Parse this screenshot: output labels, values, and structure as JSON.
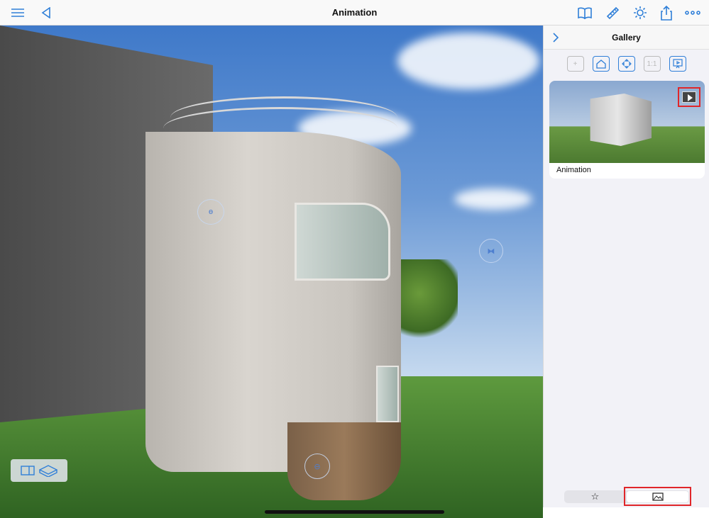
{
  "topbar": {
    "title": "Animation",
    "left_icons": [
      "menu-icon",
      "back-icon"
    ],
    "right_icons": [
      "book-icon",
      "ruler-icon",
      "sun-icon",
      "share-icon",
      "more-icon"
    ]
  },
  "gallery": {
    "title": "Gallery",
    "tools": [
      {
        "name": "add-icon",
        "label": "+",
        "enabled": false
      },
      {
        "name": "home-icon",
        "label": "",
        "enabled": true
      },
      {
        "name": "fit-icon",
        "label": "",
        "enabled": true
      },
      {
        "name": "one-to-one-icon",
        "label": "1:1",
        "enabled": false
      },
      {
        "name": "presentation-icon",
        "label": "",
        "enabled": true
      }
    ],
    "items": [
      {
        "label": "Animation",
        "badge": "play-icon"
      }
    ],
    "segments": [
      {
        "name": "favorites-tab",
        "icon": "☆",
        "active": false
      },
      {
        "name": "gallery-tab",
        "icon": "▢",
        "active": true
      }
    ]
  },
  "colors": {
    "accent": "#2f7fd8",
    "highlight": "#e0262a"
  }
}
